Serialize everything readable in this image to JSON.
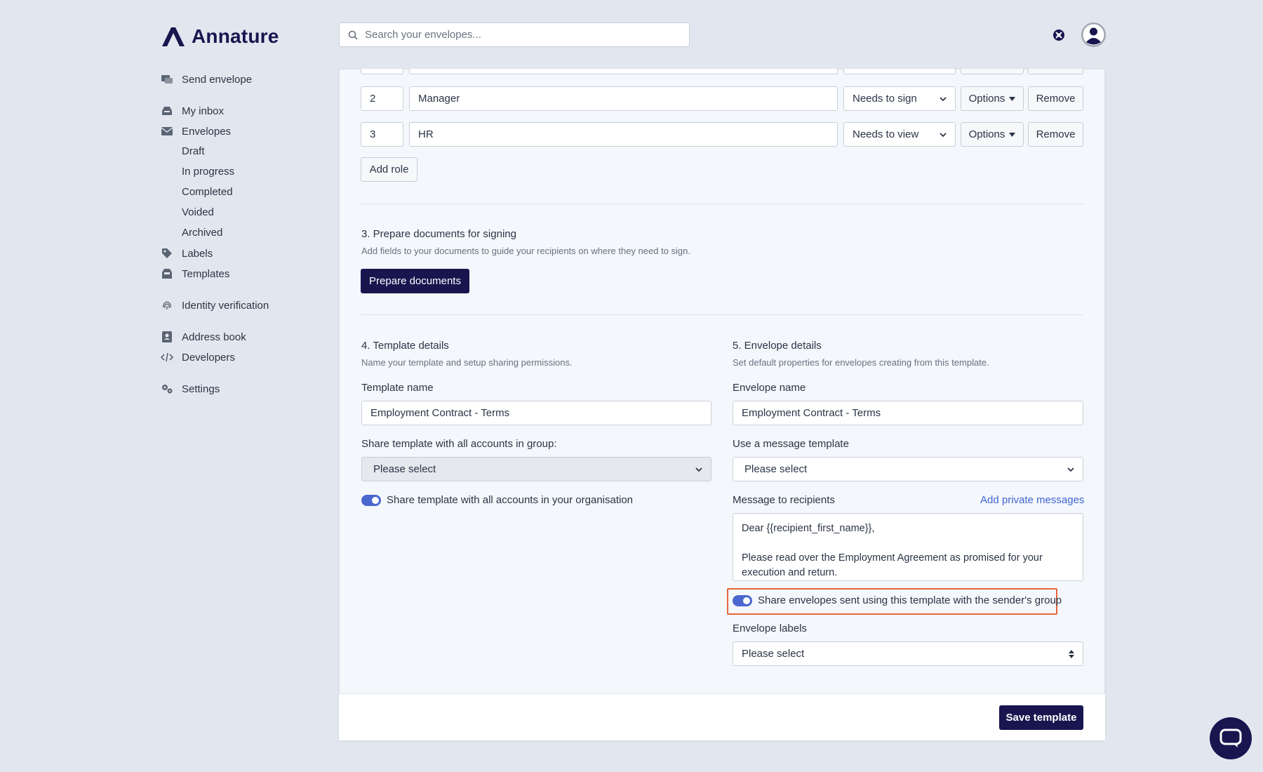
{
  "brand": {
    "name": "Annature"
  },
  "search": {
    "placeholder": "Search your envelopes..."
  },
  "sidebar": {
    "send_envelope": "Send envelope",
    "my_inbox": "My inbox",
    "envelopes": "Envelopes",
    "envelope_subitems": [
      "Draft",
      "In progress",
      "Completed",
      "Voided",
      "Archived"
    ],
    "labels": "Labels",
    "templates": "Templates",
    "identity_verification": "Identity verification",
    "address_book": "Address book",
    "developers": "Developers",
    "settings": "Settings"
  },
  "roles": {
    "rows": [
      {
        "order": "2",
        "name": "Manager",
        "action": "Needs to sign"
      },
      {
        "order": "3",
        "name": "HR",
        "action": "Needs to view"
      }
    ],
    "options_label": "Options",
    "remove_label": "Remove",
    "add_role_label": "Add role"
  },
  "prepare": {
    "title": "3. Prepare documents for signing",
    "subtitle": "Add fields to your documents to guide your recipients on where they need to sign.",
    "button": "Prepare documents"
  },
  "template_details": {
    "title": "4. Template details",
    "subtitle": "Name your template and setup sharing permissions.",
    "name_label": "Template name",
    "name_value": "Employment Contract - Terms",
    "share_group_label": "Share template with all accounts in group:",
    "share_group_value": "Please select",
    "share_org_label": "Share template with all accounts in your organisation"
  },
  "envelope_details": {
    "title": "5. Envelope details",
    "subtitle": "Set default properties for envelopes creating from this template.",
    "name_label": "Envelope name",
    "name_value": "Employment Contract - Terms",
    "message_template_label": "Use a message template",
    "message_template_value": "Please select",
    "message_label": "Message to recipients",
    "private_messages_link": "Add private messages",
    "message_line1": "Dear {{recipient_first_name}},",
    "message_line2": "Please read over the Employment Agreement as promised for your execution and return.",
    "share_sender_group_label": "Share envelopes sent using this template with the sender's group",
    "labels_label": "Envelope labels",
    "labels_value": "Please select"
  },
  "footer": {
    "save_label": "Save template"
  },
  "colors": {
    "brand": "#18154f",
    "toggle": "#4a67d0",
    "highlight": "#e8643a",
    "link": "#3e64d6"
  }
}
